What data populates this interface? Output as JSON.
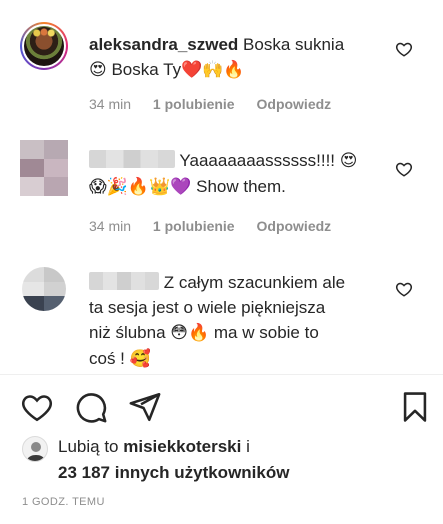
{
  "comments": [
    {
      "username": "aleksandra_szwed",
      "text_line1": " Boska suknia",
      "text_line2_suffix": " Boska Ty",
      "emojis_line2_pre": "😍",
      "emojis_line2_post": "❤️🙌🔥",
      "time": "34 min",
      "likes": "1 polubienie",
      "reply": "Odpowiedz"
    },
    {
      "username_hidden": true,
      "text_line1": "Yaaaaaaaassssss!!!! ",
      "emoji_line1": "😍",
      "emojis_line2": "😱🎉🔥👑💜",
      "text_line2": " Show them.",
      "time": "34 min",
      "likes": "1 polubienie",
      "reply": "Odpowiedz"
    },
    {
      "username_hidden": true,
      "text_line1": "Z całym szacunkiem ale",
      "text_line2": "ta sesja jest o wiele piękniejsza",
      "text_line3_pre": "niż ślubna ",
      "emojis_line3": "😳🔥",
      "text_line3_post": " ma w sobie to",
      "text_line4": "coś ! ",
      "emoji_line4": "🥰"
    }
  ],
  "likes_section": {
    "prefix": "Lubią to ",
    "first_liker": "misiekkoterski",
    "joiner": " i",
    "others": "23 187 innych użytkowników"
  },
  "timestamp": "1 GODZ. TEMU",
  "icons": [
    "heart-icon",
    "comment-icon",
    "share-icon",
    "bookmark-icon"
  ],
  "colors": {
    "text": "#262626",
    "meta": "#8e8e8e",
    "divider": "#efefef"
  }
}
